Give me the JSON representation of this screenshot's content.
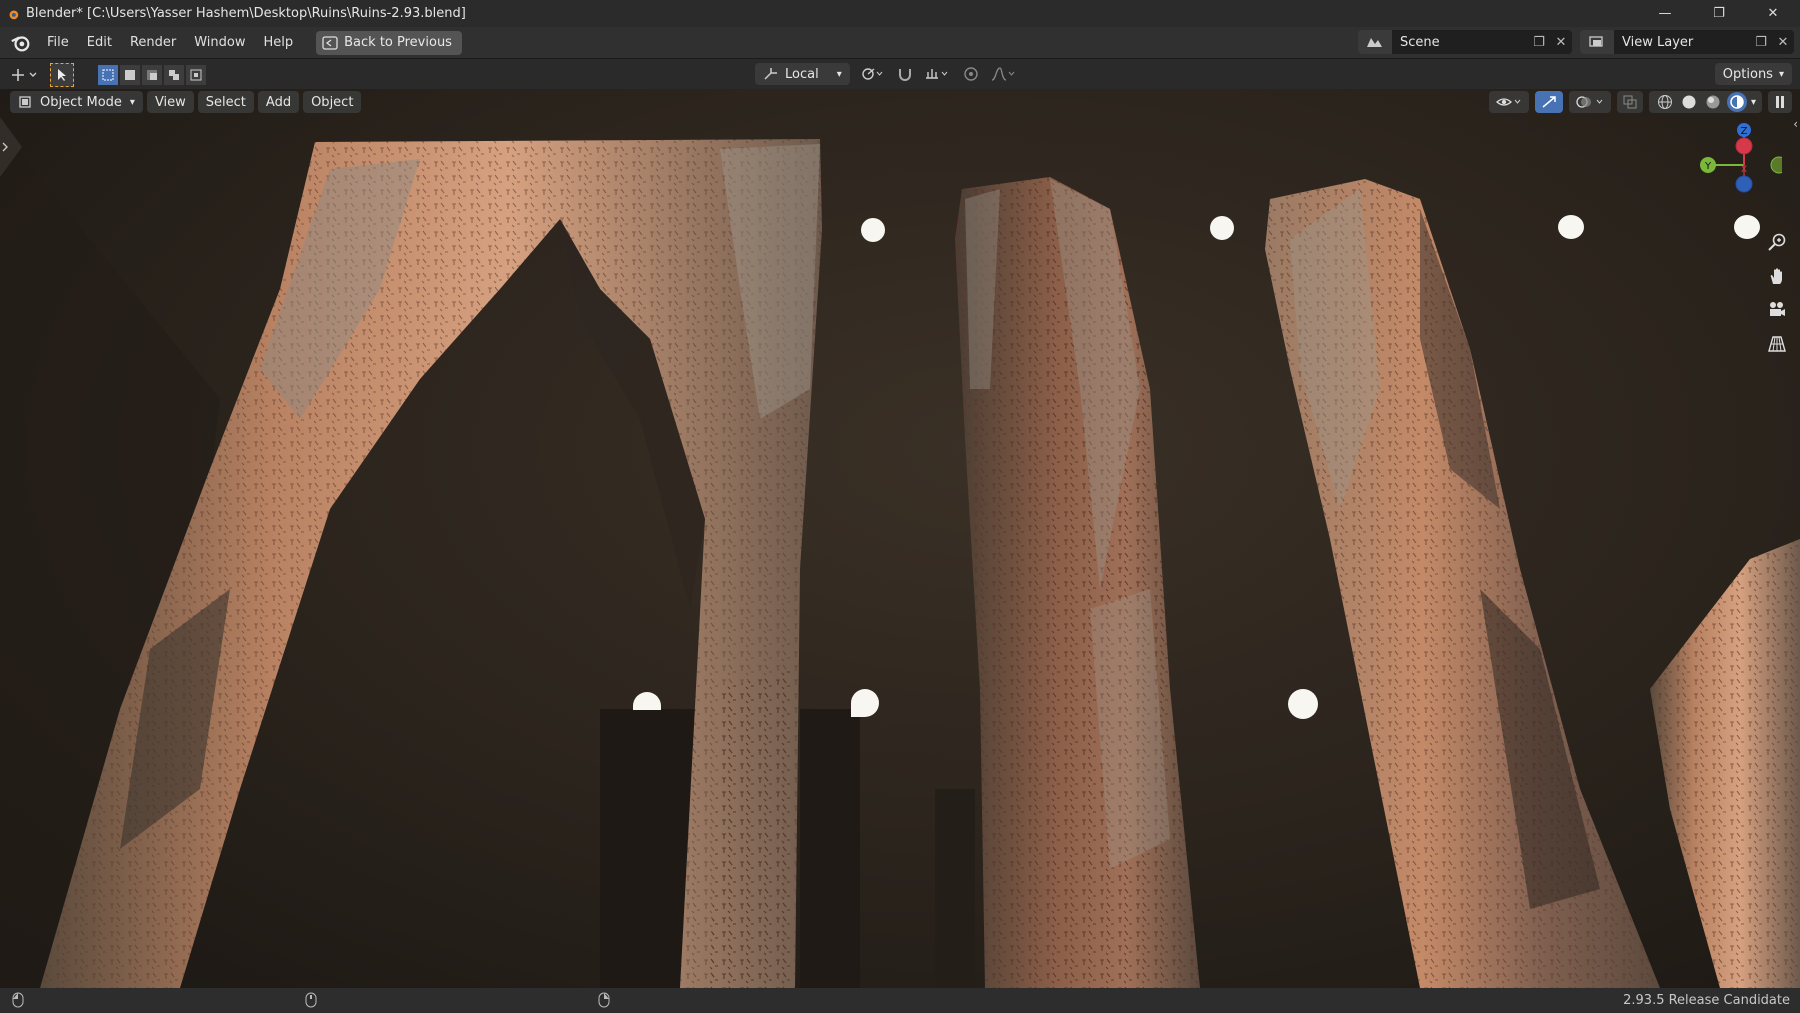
{
  "window": {
    "title": "Blender* [C:\\Users\\Yasser Hashem\\Desktop\\Ruins\\Ruins-2.93.blend]",
    "controls": [
      "—",
      "❐",
      "✕"
    ]
  },
  "menubar": {
    "items": [
      "File",
      "Edit",
      "Render",
      "Window",
      "Help"
    ],
    "back_button": "Back to Previous",
    "scene": "Scene",
    "view_layer": "View Layer"
  },
  "toolheader": {
    "transform_orientation": "Local",
    "options": "Options"
  },
  "viewport": {
    "mode": "Object Mode",
    "menus": [
      "View",
      "Select",
      "Add",
      "Object"
    ],
    "gizmo_axes": [
      "Z",
      "Y",
      "X"
    ],
    "accent": "#4772b3"
  },
  "statusbar": {
    "version": "2.93.5 Release Candidate"
  }
}
